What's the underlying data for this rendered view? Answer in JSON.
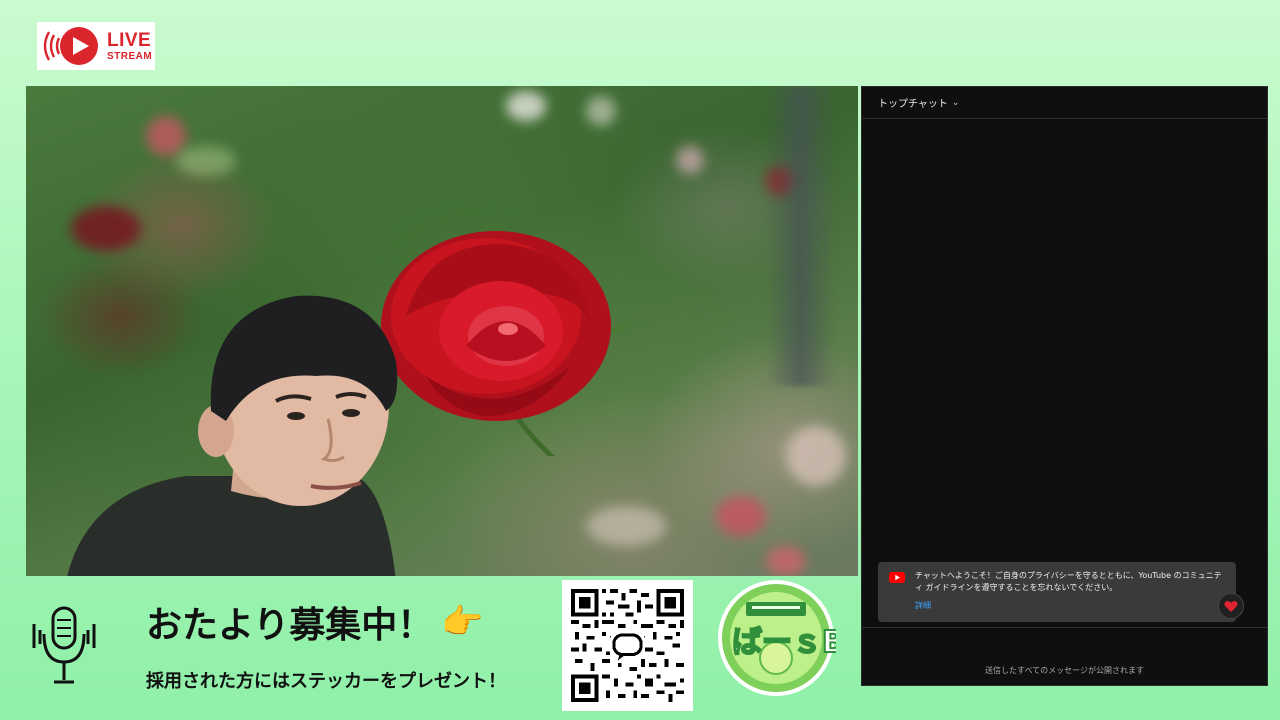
{
  "badge": {
    "live": "LIVE",
    "stream": "STREAM"
  },
  "banner": {
    "headline": "おたより募集中！",
    "subtext": "採用された方にはステッカーをプレゼント！",
    "pointing_emoji": "👉"
  },
  "logo": {
    "main": "ばーｓBar"
  },
  "chat": {
    "header_title": "トップチャット",
    "welcome_text": "チャットへようこそ！ご自身のプライバシーを守るとともに、YouTube のコミュニティ ガイドラインを遵守することを忘れないでください。",
    "details_link": "詳細",
    "footer_text": "送信したすべてのメッセージが公開されます"
  },
  "colors": {
    "background": "#a6f5b8",
    "live_red": "#d9252b",
    "chat_bg": "#0f0f0f",
    "link_blue": "#3ea6ff"
  },
  "icons": [
    "live-broadcast-icon",
    "microphone-icon",
    "chevron-down-icon",
    "youtube-icon",
    "heart-icon",
    "pointing-hand-icon"
  ]
}
